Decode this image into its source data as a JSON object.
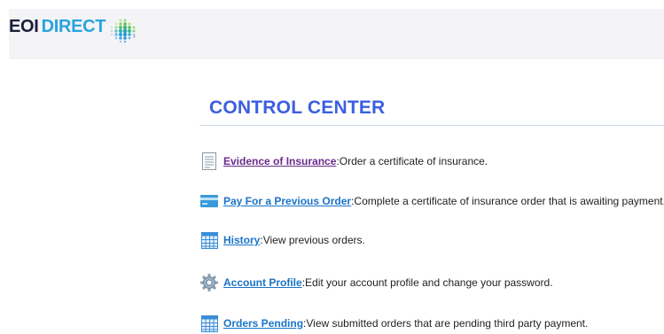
{
  "brand": {
    "part1": "EOI",
    "part2": "DIRECT",
    "trademark": "®",
    "colors": {
      "dark": "#1a1d3a",
      "blue": "#29a3df"
    }
  },
  "page": {
    "title": "CONTROL CENTER"
  },
  "items": [
    {
      "icon": "document-icon",
      "link": "Evidence of Insurance",
      "separator": ":",
      "desc": " Order a certificate of insurance."
    },
    {
      "icon": "credit-card-icon",
      "link": "Pay For a Previous Order",
      "separator": ":",
      "desc": " Complete a certificate of insurance order that is awaiting payment."
    },
    {
      "icon": "table-icon",
      "link": "History",
      "separator": ":",
      "desc": " View previous orders."
    },
    {
      "icon": "gear-icon",
      "link": "Account Profile",
      "separator": ":",
      "desc": " Edit your account profile and change your password."
    },
    {
      "icon": "table-icon",
      "link": "Orders Pending",
      "separator": ":",
      "desc": " View submitted orders that are pending third party payment."
    }
  ],
  "colors": {
    "title": "#3b5fe0",
    "link": "#1a73c9",
    "visited_link": "#6a2b8a",
    "header_bg": "#f4f4f6"
  }
}
